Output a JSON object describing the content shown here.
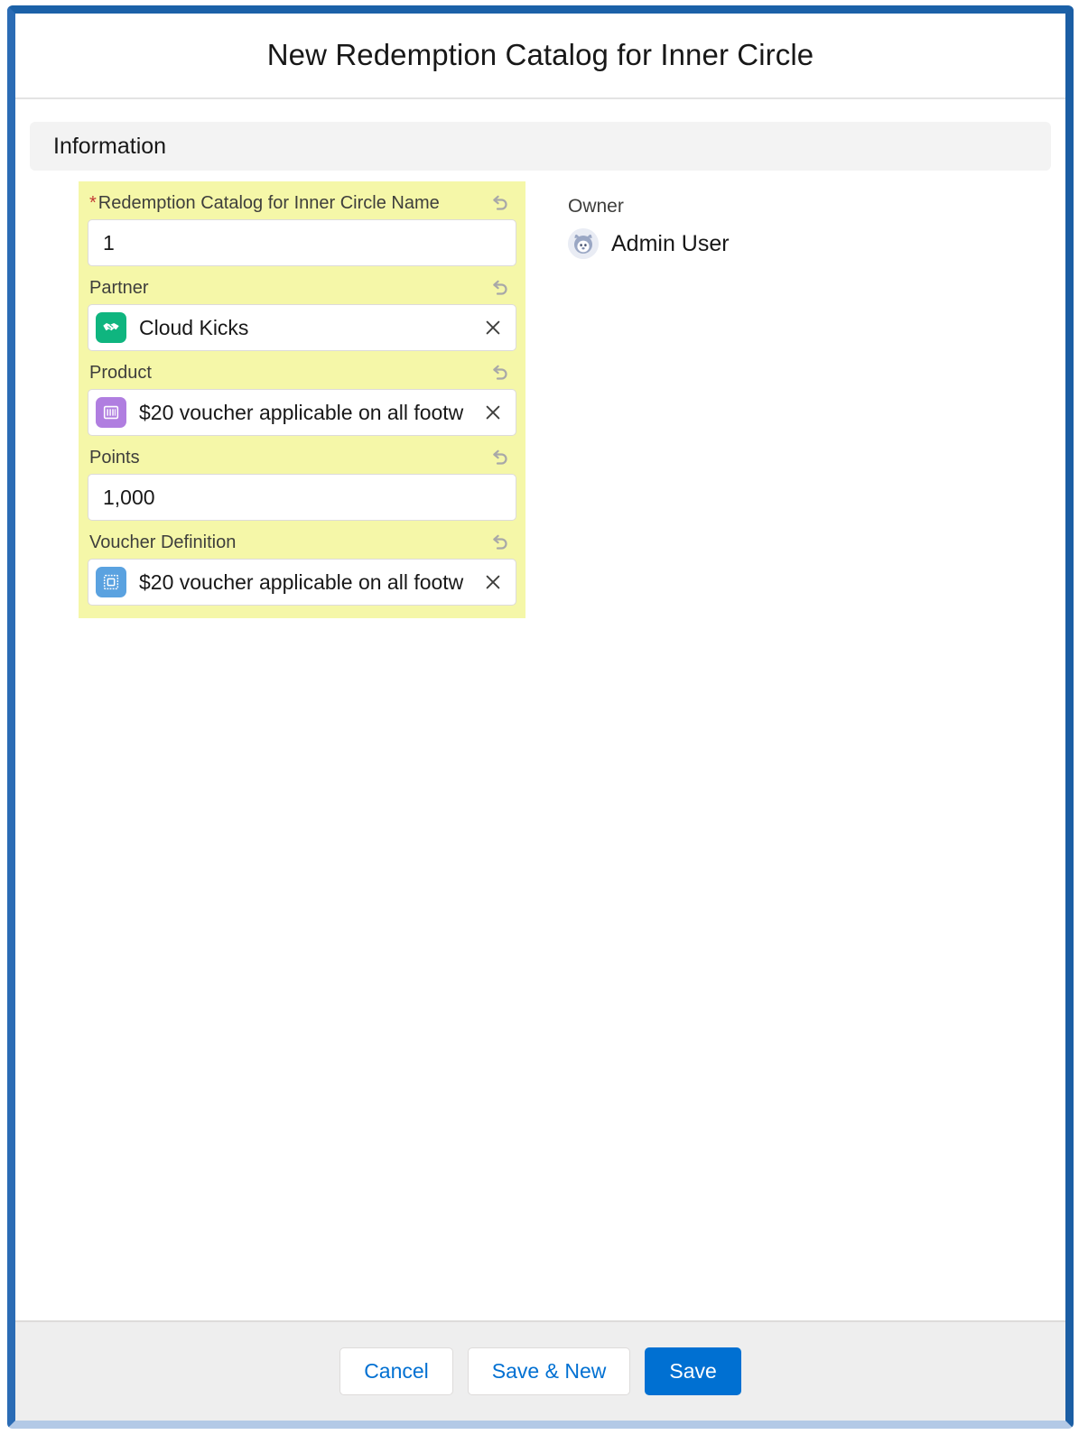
{
  "modal": {
    "title": "New Redemption Catalog for Inner Circle",
    "section": {
      "title": "Information"
    },
    "fields": {
      "name": {
        "label": "Redemption Catalog for Inner Circle Name",
        "required_marker": "*",
        "value": "1",
        "undo_icon": "undo-arrow-icon"
      },
      "partner": {
        "label": "Partner",
        "value": "Cloud Kicks",
        "icon_name": "partner-handshake-icon",
        "icon_color": "#0fb57f",
        "clear_icon": "close-x-icon",
        "undo_icon": "undo-arrow-icon"
      },
      "product": {
        "label": "Product",
        "value": "$20 voucher applicable on all footw",
        "icon_name": "product-barcode-icon",
        "icon_color": "#b07ee0",
        "clear_icon": "close-x-icon",
        "undo_icon": "undo-arrow-icon"
      },
      "points": {
        "label": "Points",
        "value": "1,000",
        "undo_icon": "undo-arrow-icon"
      },
      "voucher_definition": {
        "label": "Voucher Definition",
        "value": "$20 voucher applicable on all footw",
        "icon_name": "voucher-stamp-icon",
        "icon_color": "#5aa2e0",
        "clear_icon": "close-x-icon",
        "undo_icon": "undo-arrow-icon"
      }
    },
    "owner": {
      "label": "Owner",
      "name": "Admin User",
      "avatar_icon": "default-user-avatar-icon"
    },
    "footer": {
      "cancel_label": "Cancel",
      "save_new_label": "Save & New",
      "save_label": "Save"
    }
  },
  "theme": {
    "brand_blue": "#0070d2",
    "modal_border_blue": "#1b61a8",
    "highlight_yellow": "#f5f7a8",
    "required_red": "#c23934",
    "section_gray": "#f3f3f3",
    "footer_gray": "#eeeeee"
  }
}
